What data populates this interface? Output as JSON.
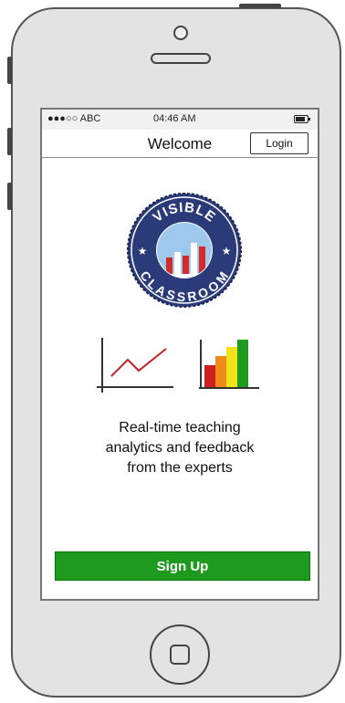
{
  "status_bar": {
    "carrier": "●●●○○ ABC",
    "time": "04:46 AM"
  },
  "nav_bar": {
    "title": "Welcome",
    "login_label": "Login"
  },
  "logo": {
    "top_text": "VISIBLE",
    "bottom_text": "CLASSROOM",
    "ring_color": "#2b3a78"
  },
  "feature_icons": [
    "line-chart-icon",
    "bar-chart-icon"
  ],
  "tagline": {
    "line1": "Real-time teaching",
    "line2": "analytics and feedback",
    "line3": "from the experts"
  },
  "signup_label": "Sign Up",
  "colors": {
    "accent": "#1e9a1e"
  }
}
